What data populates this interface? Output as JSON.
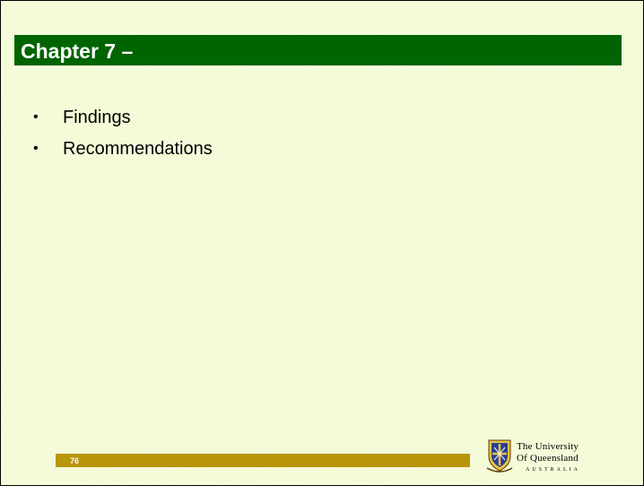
{
  "slide": {
    "title": "Chapter 7 –",
    "bullets": [
      {
        "marker": "•",
        "text": "Findings"
      },
      {
        "marker": "•",
        "text": "Recommendations"
      }
    ],
    "page_number": "76"
  },
  "logo": {
    "line1": "The University",
    "line2": "Of Queensland",
    "line3": "AUSTRALIA",
    "crest_icon": "uq-crest-icon"
  },
  "colors": {
    "title_bar": "#006400",
    "footer_bar": "#b8960c",
    "background": "#f2fad0"
  }
}
